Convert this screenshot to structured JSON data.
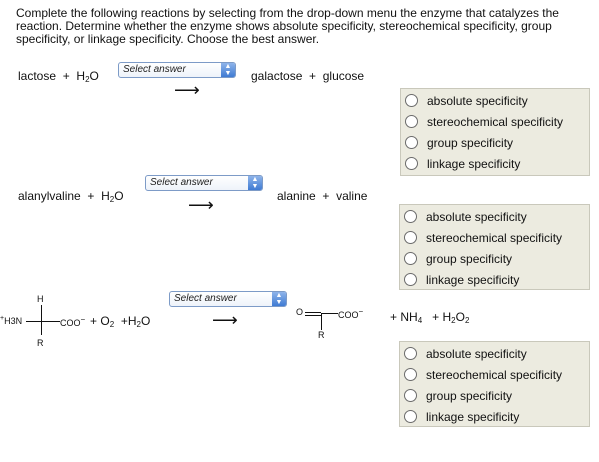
{
  "intro": "Complete the following reactions by selecting from the drop-down menu the enzyme that catalyzes the reaction. Determine whether the enzyme shows absolute specificity, stereochemical specificity, group specificity, or linkage specificity. Choose the best answer.",
  "reactions": [
    {
      "reactant1": "lactose",
      "plus1": "+",
      "water_H": "H",
      "water_2": "2",
      "water_O": "O",
      "select_placeholder": "Select answer",
      "arrow": "⟶",
      "product1": "galactose",
      "plus2": "+",
      "product2": "glucose",
      "options": [
        "absolute specificity",
        "stereochemical specificity",
        "group specificity",
        "linkage specificity"
      ]
    },
    {
      "reactant1": "alanylvaline",
      "plus1": "+",
      "water_H": "H",
      "water_2": "2",
      "water_O": "O",
      "select_placeholder": "Select answer",
      "arrow": "⟶",
      "product1": "alanine",
      "plus2": "+",
      "product2": "valine",
      "options": [
        "absolute specificity",
        "stereochemical specificity",
        "group specificity",
        "linkage specificity"
      ]
    },
    {
      "top_H": "H",
      "left_group": "H3N",
      "left_plus": "+",
      "right_coo": "COO",
      "minus": "−",
      "bottom_R": "R",
      "plus_o2": "+ O",
      "o2_sub": "2",
      "plus_h2o": "+H",
      "h2o_sub": "2",
      "h2o_O": "O",
      "select_placeholder": "Select answer",
      "arrow": "⟶",
      "product_O": "O",
      "product_coo": "COO",
      "product_minus": "−",
      "product_R": "R",
      "plus_nh4": "+ NH",
      "nh4_sub": "4",
      "plus_h2o2": "+ H",
      "h2o2_sub1": "2",
      "h2o2_O": "O",
      "h2o2_sub2": "2",
      "options": [
        "absolute specificity",
        "stereochemical specificity",
        "group specificity",
        "linkage specificity"
      ]
    }
  ]
}
